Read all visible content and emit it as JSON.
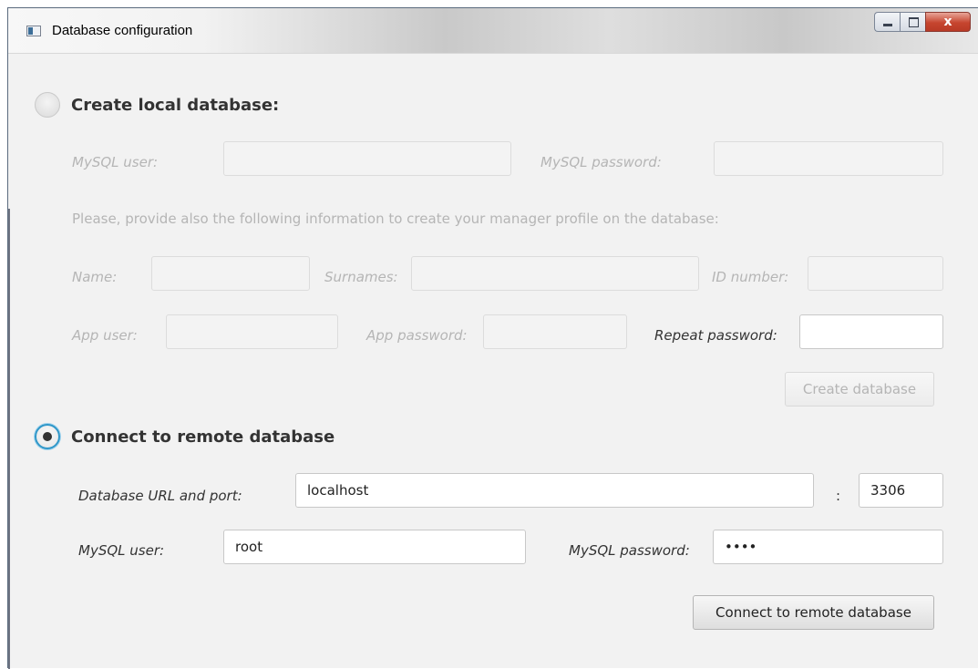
{
  "window": {
    "title": "Database configuration",
    "close_glyph": "x"
  },
  "local": {
    "heading": "Create local database:",
    "mysql_user_label": "MySQL user:",
    "mysql_password_label": "MySQL password:",
    "info_text": "Please, provide also the following information to create your manager profile on the database:",
    "name_label": "Name:",
    "surnames_label": "Surnames:",
    "id_label": "ID number:",
    "app_user_label": "App user:",
    "app_password_label": "App password:",
    "repeat_password_label": "Repeat password:",
    "create_button": "Create database"
  },
  "remote": {
    "heading": "Connect to remote database",
    "url_label": "Database URL and port:",
    "url_value": "localhost",
    "port_separator": ":",
    "port_value": "3306",
    "mysql_user_label": "MySQL user:",
    "mysql_user_value": "root",
    "mysql_password_label": "MySQL password:",
    "mysql_password_value": "••••",
    "connect_button": "Connect to remote database"
  }
}
